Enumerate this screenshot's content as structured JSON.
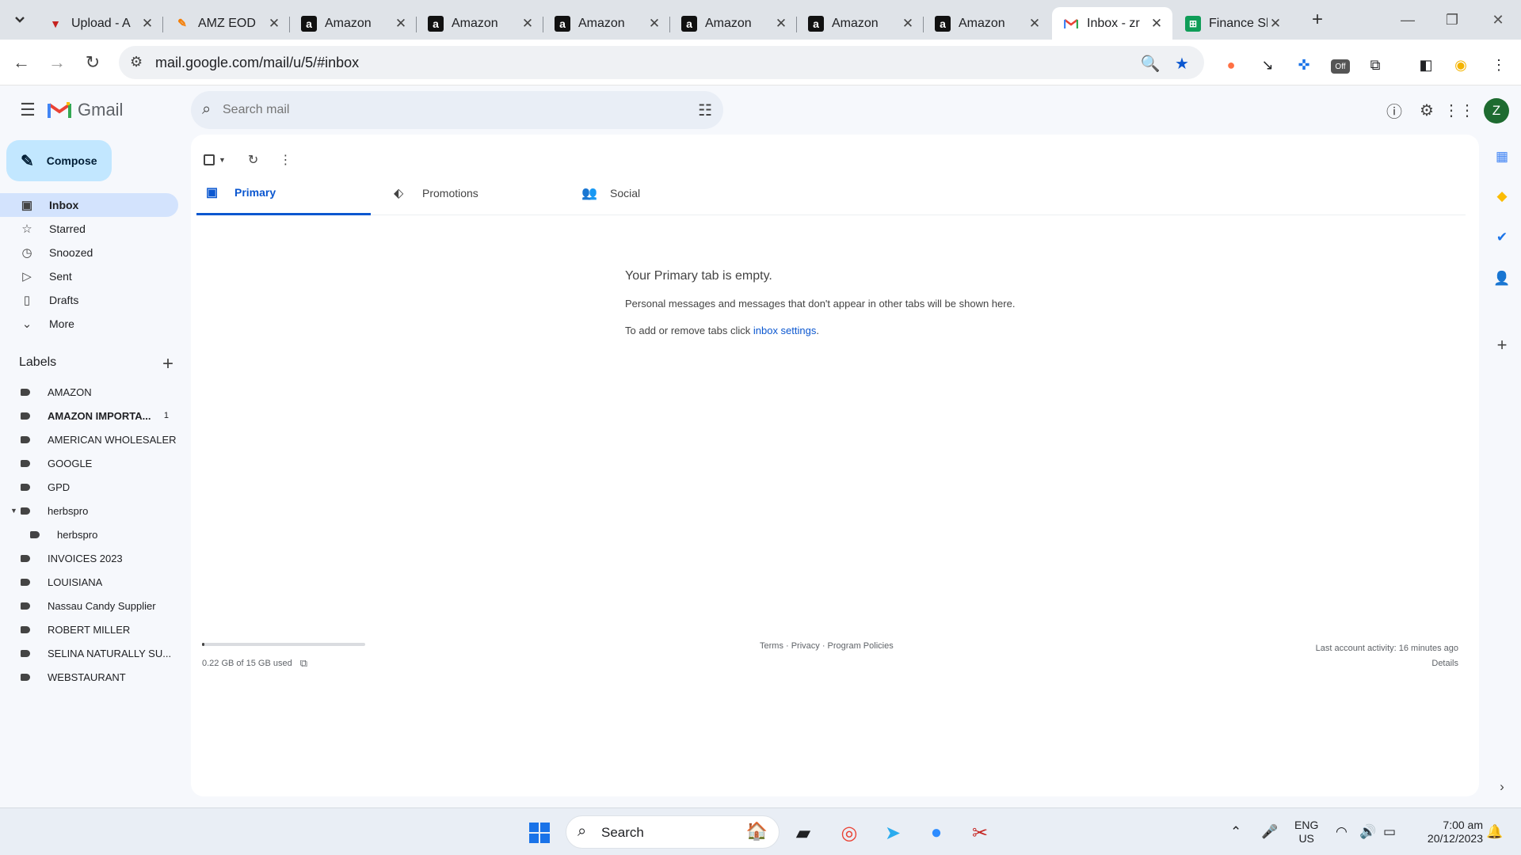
{
  "browser": {
    "tabs": [
      {
        "title": "Upload - A",
        "favicon": "up-arrow-icon"
      },
      {
        "title": "AMZ EOD",
        "favicon": "pencil-icon"
      },
      {
        "title": "Amazon",
        "favicon": "amazon-icon"
      },
      {
        "title": "Amazon",
        "favicon": "amazon-icon"
      },
      {
        "title": "Amazon",
        "favicon": "amazon-icon"
      },
      {
        "title": "Amazon",
        "favicon": "amazon-icon"
      },
      {
        "title": "Amazon",
        "favicon": "amazon-icon"
      },
      {
        "title": "Amazon",
        "favicon": "amazon-icon"
      },
      {
        "title": "Inbox - zr",
        "favicon": "gmail-icon",
        "active": true
      },
      {
        "title": "Finance Sh",
        "favicon": "sheets-icon"
      }
    ],
    "url": "mail.google.com/mail/u/5/#inbox",
    "extension_badge": "Off"
  },
  "gmail": {
    "brand": "Gmail",
    "search_placeholder": "Search mail",
    "avatar_letter": "Z",
    "compose_label": "Compose",
    "nav": [
      {
        "label": "Inbox",
        "icon": "inbox-icon",
        "active": true
      },
      {
        "label": "Starred",
        "icon": "star-icon"
      },
      {
        "label": "Snoozed",
        "icon": "clock-icon"
      },
      {
        "label": "Sent",
        "icon": "send-icon"
      },
      {
        "label": "Drafts",
        "icon": "draft-icon"
      },
      {
        "label": "More",
        "icon": "chevron-down-icon"
      }
    ],
    "labels_title": "Labels",
    "labels": [
      {
        "name": "AMAZON"
      },
      {
        "name": "AMAZON IMPORTA...",
        "count": "1",
        "bold": true
      },
      {
        "name": "AMERICAN WHOLESALER"
      },
      {
        "name": "GOOGLE"
      },
      {
        "name": "GPD"
      },
      {
        "name": "herbspro",
        "expanded": true
      },
      {
        "name": "herbspro",
        "nested": true
      },
      {
        "name": "INVOICES 2023"
      },
      {
        "name": "LOUISIANA"
      },
      {
        "name": "Nassau Candy Supplier"
      },
      {
        "name": "ROBERT MILLER"
      },
      {
        "name": "SELINA NATURALLY SU..."
      },
      {
        "name": "WEBSTAURANT"
      }
    ],
    "tabs": [
      {
        "label": "Primary",
        "icon": "inbox-icon",
        "active": true
      },
      {
        "label": "Promotions",
        "icon": "tag-icon"
      },
      {
        "label": "Social",
        "icon": "people-icon"
      }
    ],
    "empty": {
      "title": "Your Primary tab is empty.",
      "line1": "Personal messages and messages that don't appear in other tabs will be shown here.",
      "line2_prefix": "To add or remove tabs click ",
      "line2_link": "inbox settings",
      "line2_suffix": "."
    },
    "footer": {
      "storage_used": "0.22 GB of 15 GB used",
      "storage_fraction": 0.015,
      "links": "Terms · Privacy · Program Policies",
      "last_activity": "Last account activity: 16 minutes ago",
      "details": "Details"
    }
  },
  "taskbar": {
    "search_label": "Search",
    "lang_line1": "ENG",
    "lang_line2": "US",
    "time": "7:00 am",
    "date": "20/12/2023"
  },
  "colors": {
    "accent": "#0b57d0",
    "compose_bg": "#c2e7ff",
    "active_nav": "#d3e3fd",
    "avatar": "#1e6b30"
  }
}
